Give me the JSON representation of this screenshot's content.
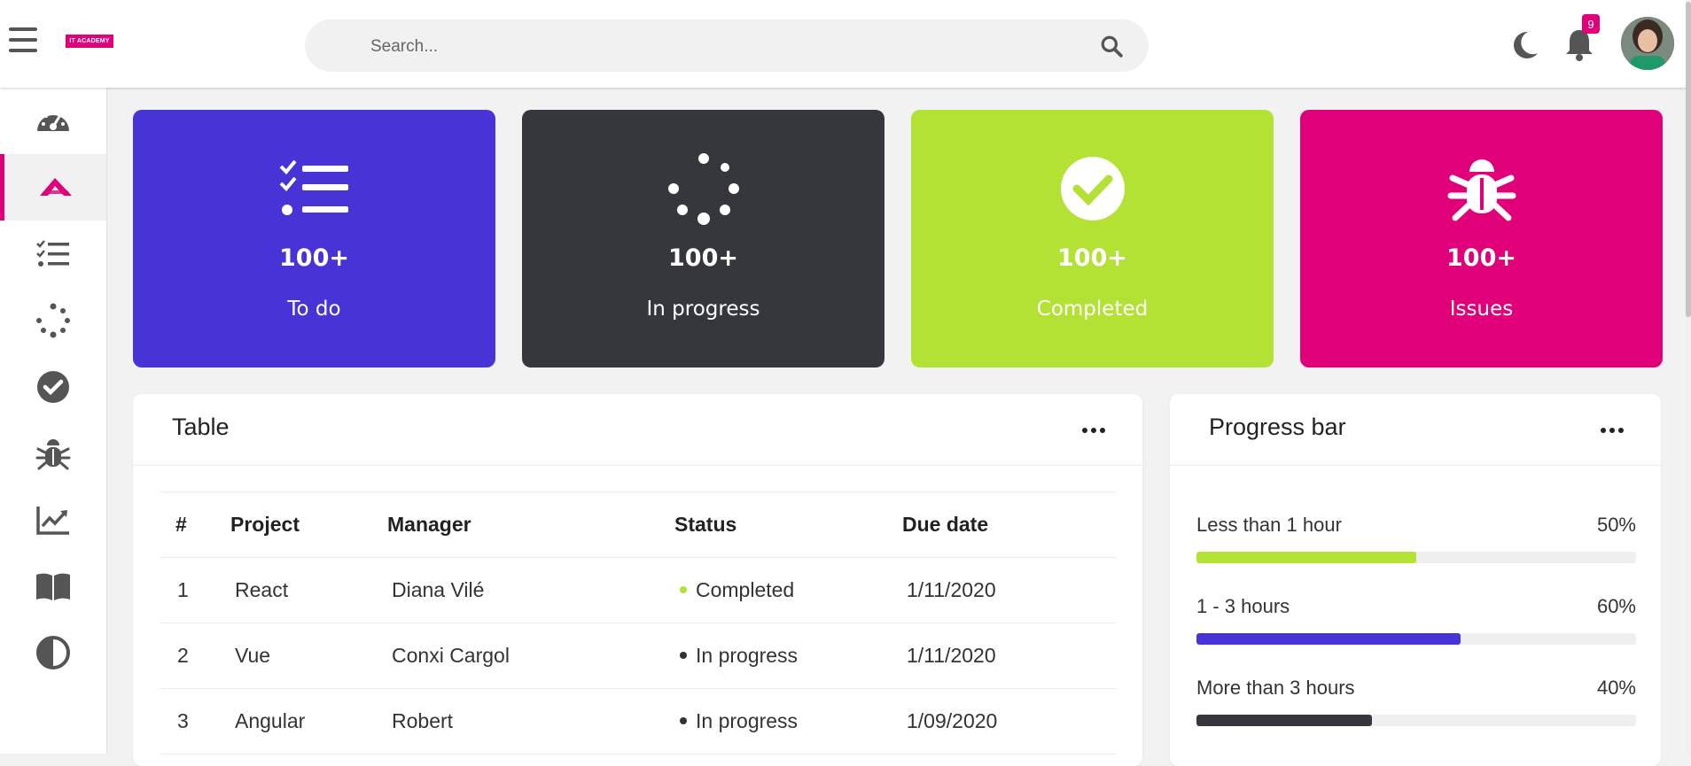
{
  "header": {
    "logo_text": "IT ACADEMY",
    "search_placeholder": "Search...",
    "notification_count": "9",
    "icons": [
      "menu-icon",
      "search-icon",
      "moon-icon",
      "bell-icon"
    ]
  },
  "sidebar": {
    "items": [
      {
        "name": "dashboard",
        "icon": "gauge-icon",
        "active": false
      },
      {
        "name": "academy",
        "icon": "academy-logo-icon",
        "active": true
      },
      {
        "name": "todo",
        "icon": "checklist-icon",
        "active": false
      },
      {
        "name": "in-progress",
        "icon": "spinner-icon",
        "active": false
      },
      {
        "name": "completed",
        "icon": "check-circle-icon",
        "active": false
      },
      {
        "name": "issues",
        "icon": "bug-icon",
        "active": false
      },
      {
        "name": "charts",
        "icon": "chart-line-icon",
        "active": false
      },
      {
        "name": "docs",
        "icon": "book-icon",
        "active": false
      },
      {
        "name": "theme",
        "icon": "contrast-icon",
        "active": false
      }
    ]
  },
  "cards": [
    {
      "value": "100+",
      "label": "To do",
      "color": "#4733d6",
      "icon": "checklist-icon"
    },
    {
      "value": "100+",
      "label": "In progress",
      "color": "#35373c",
      "icon": "spinner-icon"
    },
    {
      "value": "100+",
      "label": "Completed",
      "color": "#b3e134",
      "icon": "check-circle-icon"
    },
    {
      "value": "100+",
      "label": "Issues",
      "color": "#e0007a",
      "icon": "bug-icon"
    }
  ],
  "table_panel": {
    "title": "Table",
    "columns": [
      "#",
      "Project",
      "Manager",
      "Status",
      "Due date"
    ],
    "rows": [
      {
        "num": "1",
        "project": "React",
        "manager": "Diana Vilé",
        "status": "Completed",
        "status_color": "#b3e134",
        "due": "1/11/2020"
      },
      {
        "num": "2",
        "project": "Vue",
        "manager": "Conxi Cargol",
        "status": "In progress",
        "status_color": "#333333",
        "due": "1/11/2020"
      },
      {
        "num": "3",
        "project": "Angular",
        "manager": "Robert",
        "status": "In progress",
        "status_color": "#333333",
        "due": "1/09/2020"
      }
    ]
  },
  "progress_panel": {
    "title": "Progress bar",
    "bars": [
      {
        "label": "Less than 1 hour",
        "percent_text": "50%",
        "value": 50,
        "color": "#b3e134"
      },
      {
        "label": "1 - 3 hours",
        "percent_text": "60%",
        "value": 60,
        "color": "#4733d6"
      },
      {
        "label": "More than 3 hours",
        "percent_text": "40%",
        "value": 40,
        "color": "#35373c"
      }
    ]
  }
}
